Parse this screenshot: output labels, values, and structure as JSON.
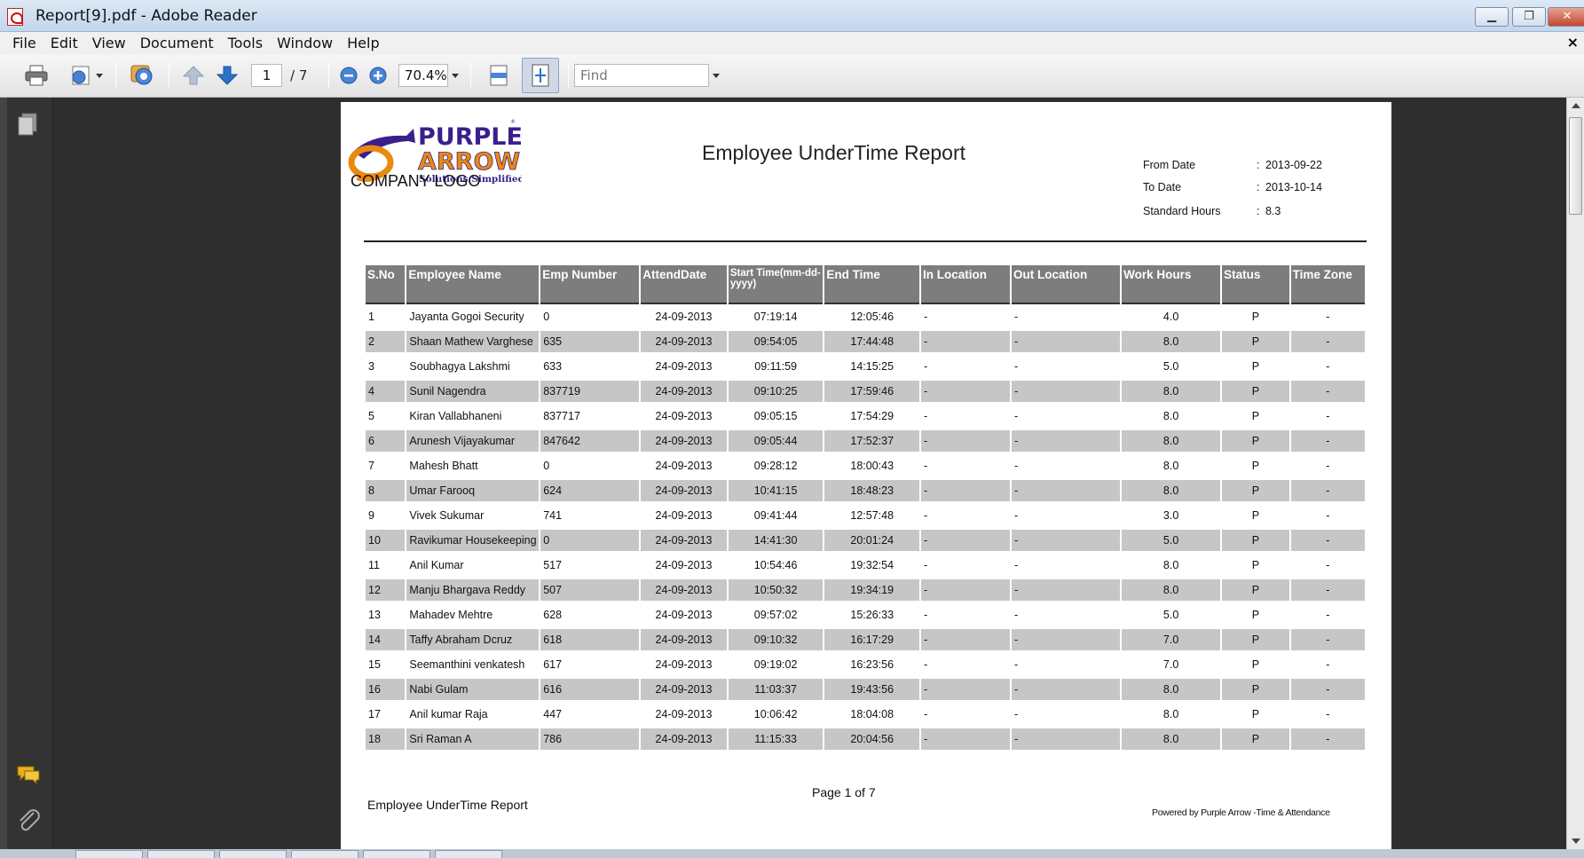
{
  "window": {
    "title": "Report[9].pdf - Adobe Reader",
    "min_glyph": "▁",
    "restore_glyph": "❐",
    "close_glyph": "✕"
  },
  "menu": {
    "items": [
      "File",
      "Edit",
      "View",
      "Document",
      "Tools",
      "Window",
      "Help"
    ],
    "close_glyph": "×"
  },
  "toolbar": {
    "page_current": "1",
    "page_total": "/ 7",
    "zoom": "70.4%",
    "find_placeholder": "Find"
  },
  "colors": {
    "accent_blue": "#2a72c9",
    "logo_purple": "#3a1f8c",
    "logo_orange": "#e88a10",
    "header_gray": "#7d7d7d",
    "row_shade": "#c6c6c6"
  },
  "report": {
    "logo_text_line1": "PURPLE",
    "logo_text_line2": "ARROW",
    "logo_tagline": "Solutions Simplified",
    "logo_caption": "COMPANY LOGO",
    "title": "Employee UnderTime Report",
    "meta": [
      {
        "label": "From Date",
        "value": "2013-09-22"
      },
      {
        "label": "To Date",
        "value": "2013-10-14"
      },
      {
        "label": "Standard Hours",
        "value": "8.3"
      }
    ],
    "meta_sep": ":",
    "columns": [
      "S.No",
      "Employee Name",
      "Emp Number",
      "AttendDate",
      "Start Time(mm-dd-yyyy)",
      "End Time",
      "In Location",
      "Out Location",
      "Work Hours",
      "Status",
      "Time Zone"
    ],
    "rows": [
      [
        "1",
        "Jayanta Gogoi  Security",
        "0",
        "24-09-2013",
        "07:19:14",
        "12:05:46",
        "-",
        "-",
        "4.0",
        "P",
        "-"
      ],
      [
        "2",
        "Shaan Mathew Varghese",
        "635",
        "24-09-2013",
        "09:54:05",
        "17:44:48",
        "-",
        "-",
        "8.0",
        "P",
        "-"
      ],
      [
        "3",
        "Soubhagya Lakshmi",
        "633",
        "24-09-2013",
        "09:11:59",
        "14:15:25",
        "-",
        "-",
        "5.0",
        "P",
        "-"
      ],
      [
        "4",
        "Sunil  Nagendra",
        "837719",
        "24-09-2013",
        "09:10:25",
        "17:59:46",
        "-",
        "-",
        "8.0",
        "P",
        "-"
      ],
      [
        "5",
        "Kiran  Vallabhaneni",
        "837717",
        "24-09-2013",
        "09:05:15",
        "17:54:29",
        "-",
        "-",
        "8.0",
        "P",
        "-"
      ],
      [
        "6",
        "Arunesh Vijayakumar",
        "847642",
        "24-09-2013",
        "09:05:44",
        "17:52:37",
        "-",
        "-",
        "8.0",
        "P",
        "-"
      ],
      [
        "7",
        "Mahesh Bhatt",
        "0",
        "24-09-2013",
        "09:28:12",
        "18:00:43",
        "-",
        "-",
        "8.0",
        "P",
        "-"
      ],
      [
        "8",
        "Umar Farooq",
        "624",
        "24-09-2013",
        "10:41:15",
        "18:48:23",
        "-",
        "-",
        "8.0",
        "P",
        "-"
      ],
      [
        "9",
        "Vivek Sukumar",
        "741",
        "24-09-2013",
        "09:41:44",
        "12:57:48",
        "-",
        "-",
        "3.0",
        "P",
        "-"
      ],
      [
        "10",
        "Ravikumar Housekeeping",
        "0",
        "24-09-2013",
        "14:41:30",
        "20:01:24",
        "-",
        "-",
        "5.0",
        "P",
        "-"
      ],
      [
        "11",
        "Anil Kumar",
        "517",
        "24-09-2013",
        "10:54:46",
        "19:32:54",
        "-",
        "-",
        "8.0",
        "P",
        "-"
      ],
      [
        "12",
        "Manju Bhargava Reddy",
        "507",
        "24-09-2013",
        "10:50:32",
        "19:34:19",
        "-",
        "-",
        "8.0",
        "P",
        "-"
      ],
      [
        "13",
        "Mahadev Mehtre",
        "628",
        "24-09-2013",
        "09:57:02",
        "15:26:33",
        "-",
        "-",
        "5.0",
        "P",
        "-"
      ],
      [
        "14",
        "Taffy Abraham Dcruz",
        "618",
        "24-09-2013",
        "09:10:32",
        "16:17:29",
        "-",
        "-",
        "7.0",
        "P",
        "-"
      ],
      [
        "15",
        "Seemanthini venkatesh",
        "617",
        "24-09-2013",
        "09:19:02",
        "16:23:56",
        "-",
        "-",
        "7.0",
        "P",
        "-"
      ],
      [
        "16",
        "Nabi Gulam",
        "616",
        "24-09-2013",
        "11:03:37",
        "19:43:56",
        "-",
        "-",
        "8.0",
        "P",
        "-"
      ],
      [
        "17",
        "Anil kumar Raja",
        "447",
        "24-09-2013",
        "10:06:42",
        "18:04:08",
        "-",
        "-",
        "8.0",
        "P",
        "-"
      ],
      [
        "18",
        "Sri Raman A",
        "786",
        "24-09-2013",
        "11:15:33",
        "20:04:56",
        "-",
        "-",
        "8.0",
        "P",
        "-"
      ]
    ],
    "page_indicator": "Page 1 of 7",
    "footer_title": "Employee UnderTime Report",
    "powered_by": "Powered by Purple Arrow -Time & Attendance"
  }
}
